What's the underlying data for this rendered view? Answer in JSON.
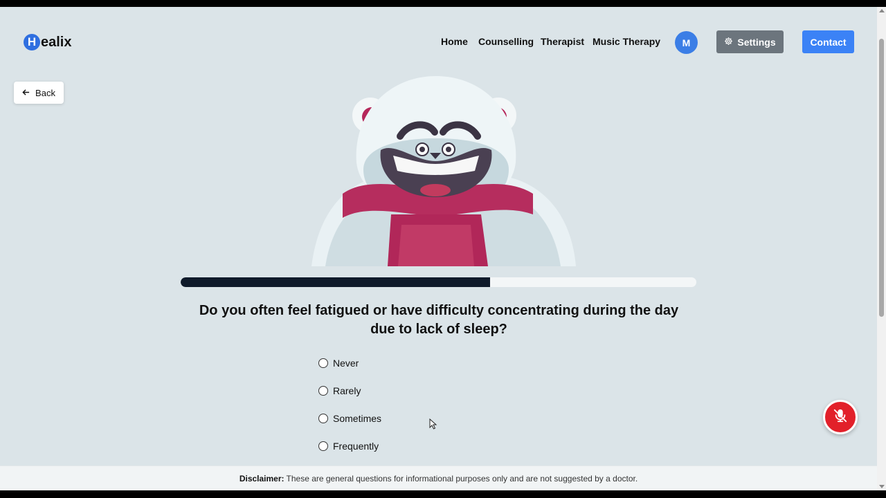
{
  "brand": {
    "logo_letter": "H",
    "logo_rest": "ealix"
  },
  "nav": {
    "items": [
      "Home",
      "Counselling",
      "Therapist",
      "Music Therapy"
    ]
  },
  "user": {
    "avatar_initial": "M"
  },
  "header": {
    "settings_label": "Settings",
    "contact_label": "Contact"
  },
  "back_label": "Back",
  "quiz": {
    "progress": 0.6,
    "question": "Do you often feel fatigued or have difficulty concentrating during the day due to lack of sleep?",
    "options": [
      "Never",
      "Rarely",
      "Sometimes",
      "Frequently"
    ]
  },
  "disclaimer": {
    "label": "Disclaimer:",
    "text": "These are general questions for informational purposes only and are not suggested by a doctor."
  },
  "colors": {
    "primary": "#3b82f6",
    "settings": "#6c757d",
    "progress_fill": "#0f1a2a",
    "mic": "#e2202a"
  },
  "icons": {
    "back": "arrow-left-icon",
    "settings": "gear-icon",
    "mic": "microphone-off-icon"
  }
}
